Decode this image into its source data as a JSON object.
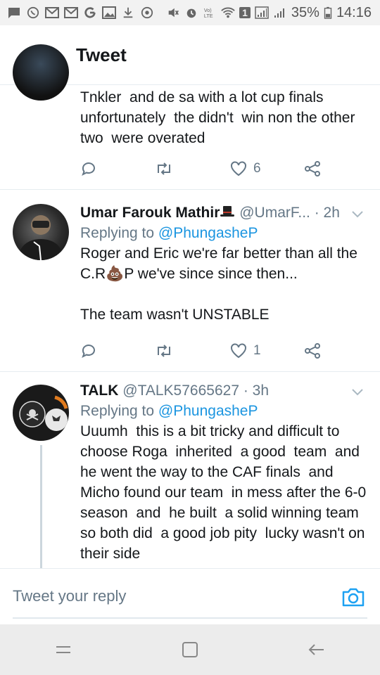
{
  "status_bar": {
    "battery": "35%",
    "time": "14:16",
    "sim_badge": "1",
    "left_icons": [
      "message-icon",
      "whatsapp-icon",
      "gmail-icon",
      "gmail-icon",
      "google-icon",
      "image-icon",
      "download-icon",
      "sync-icon"
    ],
    "right_icons": [
      "mute-icon",
      "alarm-icon",
      "volte-icon",
      "wifi-icon",
      "signal-icon",
      "signal-icon",
      "battery-icon"
    ]
  },
  "header": {
    "title": "Tweet",
    "back_icon": "arrow-left-icon"
  },
  "tweets": [
    {
      "text": "Tnkler  and de sa with a lot cup finals unfortunately  the didn't  win non the other two  were overated",
      "actions": {
        "reply_count": "",
        "retweet_count": "",
        "like_count": "6"
      }
    },
    {
      "name": "Umar Farouk Mathir",
      "handle": "@UmarF...",
      "time": "· 2h",
      "replying_prefix": "Replying to ",
      "replying_to": "@PhungasheP",
      "text": "Roger and Eric we're far better than all the C.R💩P we've since since then...\n\nThe team wasn't UNSTABLE",
      "actions": {
        "reply_count": "",
        "retweet_count": "",
        "like_count": "1"
      }
    },
    {
      "name": "TALK",
      "handle": "@TALK57665627",
      "time": "· 3h",
      "replying_prefix": "Replying to ",
      "replying_to": "@PhungasheP",
      "text": "Uuumh  this is a bit tricky and difficult to choose Roga  inherited  a good  team  and he went the way to the CAF finals  and Micho found our team  in mess after the 6-0 season  and  he built  a solid winning team so both did  a good job pity  lucky wasn't on their side"
    }
  ],
  "reply_bar": {
    "placeholder": "Tweet your reply"
  },
  "colors": {
    "accent": "#1da1f2",
    "text": "#14171a",
    "secondary": "#657786",
    "divider": "#e6ecf0"
  }
}
